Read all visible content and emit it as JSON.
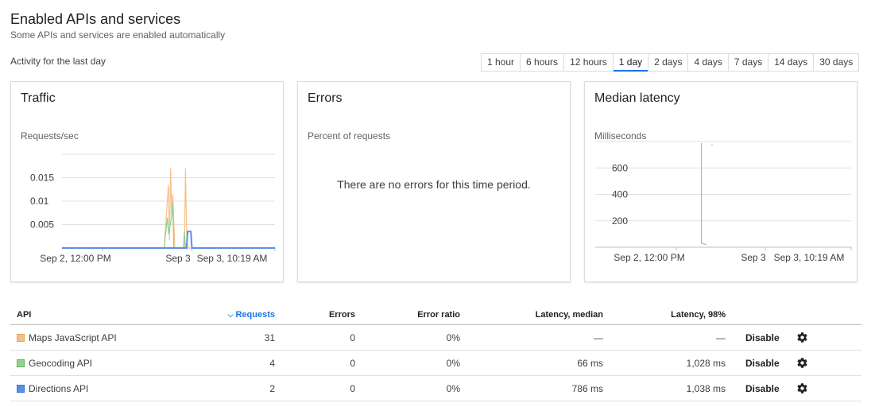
{
  "header": {
    "title": "Enabled APIs and services",
    "subtitle": "Some APIs and services are enabled automatically"
  },
  "activity_label": "Activity for the last day",
  "time_ranges": [
    "1 hour",
    "6 hours",
    "12 hours",
    "1 day",
    "2 days",
    "4 days",
    "7 days",
    "14 days",
    "30 days"
  ],
  "selected_range": "1 day",
  "colors": {
    "maps": "#f5c08a",
    "geocoding": "#8fd18f",
    "directions": "#5a8fe6",
    "accent": "#1a73e8"
  },
  "cards": {
    "traffic": {
      "title": "Traffic",
      "subtitle": "Requests/sec"
    },
    "errors": {
      "title": "Errors",
      "subtitle": "Percent of requests",
      "message": "There are no errors for this time period."
    },
    "latency": {
      "title": "Median latency",
      "subtitle": "Milliseconds"
    }
  },
  "chart_data": [
    {
      "type": "line",
      "title": "Traffic",
      "ylabel": "Requests/sec",
      "ylim": [
        0,
        0.02
      ],
      "y_ticks": [
        "0.015",
        "0.01",
        "0.005"
      ],
      "x_ticks": [
        "Sep 2, 12:00 PM",
        "Sep 3",
        "Sep 3, 10:19 AM"
      ],
      "series": [
        {
          "color": "#f5c08a",
          "points": [
            [
              0.48,
              0
            ],
            [
              0.49,
              0.007
            ],
            [
              0.5,
              0.0135
            ],
            [
              0.505,
              0.0017
            ],
            [
              0.51,
              0.017
            ],
            [
              0.515,
              0.007
            ],
            [
              0.52,
              0.0115
            ],
            [
              0.53,
              0
            ],
            [
              0.575,
              0
            ],
            [
              0.58,
              0.017
            ],
            [
              0.585,
              0.0035
            ],
            [
              0.59,
              0
            ]
          ]
        },
        {
          "color": "#8fd18f",
          "points": [
            [
              0.48,
              0
            ],
            [
              0.485,
              0.0025
            ],
            [
              0.495,
              0.0065
            ],
            [
              0.5,
              0.003
            ],
            [
              0.515,
              0.0065
            ],
            [
              0.52,
              0.0095
            ],
            [
              0.525,
              0
            ],
            [
              0.57,
              0
            ],
            [
              0.575,
              0.0035
            ],
            [
              0.58,
              0
            ]
          ]
        },
        {
          "color": "#5a8fe6",
          "points": [
            [
              0,
              0
            ],
            [
              0.585,
              0
            ],
            [
              0.59,
              0.0035
            ],
            [
              0.605,
              0.0035
            ],
            [
              0.61,
              0
            ],
            [
              1,
              0
            ]
          ]
        }
      ]
    },
    {
      "type": "line",
      "title": "Median latency",
      "ylabel": "Milliseconds",
      "ylim": [
        0,
        800
      ],
      "y_ticks": [
        "600",
        "400",
        "200"
      ],
      "x_ticks": [
        "Sep 2, 12:00 PM",
        "Sep 3",
        "Sep 3, 10:19 AM"
      ],
      "series": [
        {
          "color": "#8fd18f",
          "points": [
            [
              0.415,
              790
            ],
            [
              0.415,
              30
            ],
            [
              0.435,
              20
            ]
          ]
        }
      ]
    }
  ],
  "table": {
    "headers": {
      "api": "API",
      "requests": "Requests",
      "errors": "Errors",
      "error_ratio": "Error ratio",
      "latency_median": "Latency, median",
      "latency_98": "Latency, 98%"
    },
    "sort_icon": "sort-desc-icon",
    "disable_label": "Disable",
    "rows": [
      {
        "name": "Maps JavaScript API",
        "requests": "31",
        "errors": "0",
        "ratio": "0%",
        "median": "—",
        "p98": "—",
        "color": "#f5c08a"
      },
      {
        "name": "Geocoding API",
        "requests": "4",
        "errors": "0",
        "ratio": "0%",
        "median": "66 ms",
        "p98": "1,028 ms",
        "color": "#8fd18f"
      },
      {
        "name": "Directions API",
        "requests": "2",
        "errors": "0",
        "ratio": "0%",
        "median": "786 ms",
        "p98": "1,038 ms",
        "color": "#5a8fe6"
      }
    ]
  }
}
